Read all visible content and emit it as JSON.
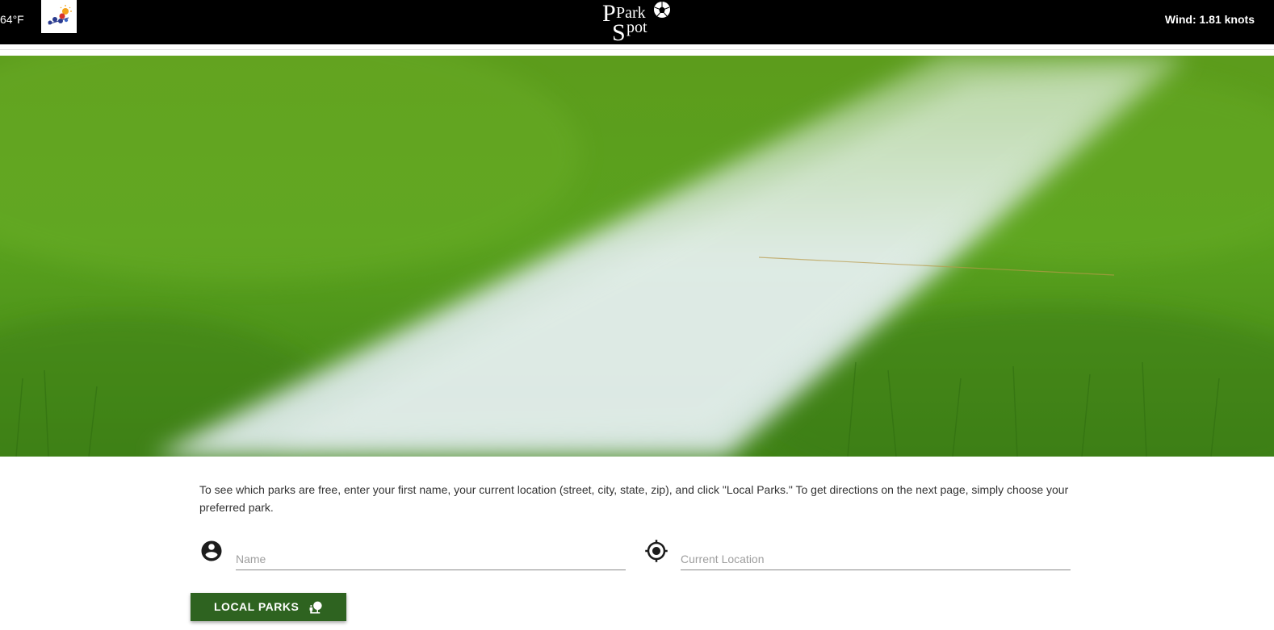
{
  "header": {
    "temperature": "64°F",
    "weather_icon": "weather-icon",
    "logo_text_top": "Park",
    "logo_text_bottom": "Spot",
    "logo_icon": "soccer-ball-icon",
    "wind": "Wind: 1.81 knots"
  },
  "hero": {
    "image": "grass-field-with-white-line"
  },
  "main": {
    "intro": "To see which parks are free, enter your first name, your current location (street, city, state, zip), and click \"Local Parks.\" To get directions on the next page, simply choose your preferred park.",
    "name_field": {
      "icon": "account-circle-icon",
      "placeholder": "Name",
      "value": ""
    },
    "location_field": {
      "icon": "my-location-icon",
      "placeholder": "Current Location",
      "value": ""
    },
    "button": {
      "label": "LOCAL PARKS",
      "icon": "nature-people-icon"
    }
  },
  "colors": {
    "topbar": "#000000",
    "button": "#2e6320",
    "grass": "#4c8c1a"
  }
}
